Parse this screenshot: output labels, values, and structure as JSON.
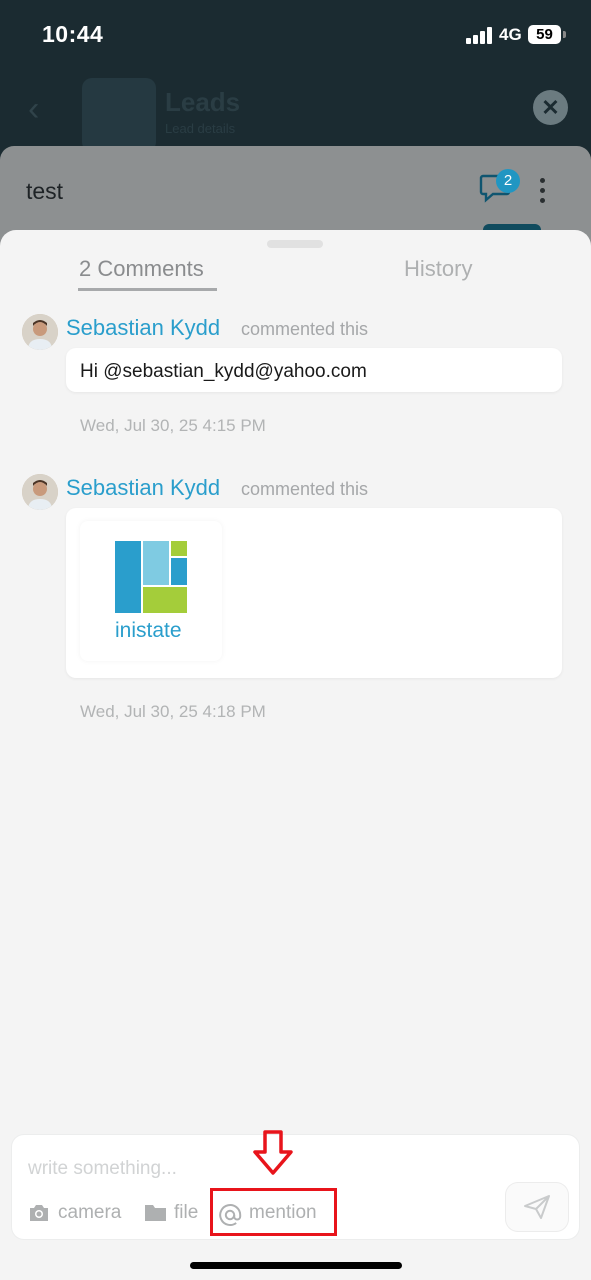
{
  "status_bar": {
    "time": "10:44",
    "network": "4G",
    "battery": "59"
  },
  "background_screen": {
    "title": "Leads",
    "subtitle": "Lead details"
  },
  "record_sheet": {
    "title": "test",
    "comment_count": "2"
  },
  "tabs": {
    "comments": "2 Comments",
    "history": "History"
  },
  "comments": [
    {
      "author": "Sebastian Kydd",
      "action": "commented this",
      "text": "Hi @sebastian_kydd@yahoo.com",
      "timestamp": "Wed, Jul 30, 25 4:15 PM"
    },
    {
      "author": "Sebastian Kydd",
      "action": "commented this",
      "attachment_label": "inistate",
      "timestamp": "Wed, Jul 30, 25 4:18 PM"
    }
  ],
  "composer": {
    "placeholder": "write something...",
    "camera_label": "camera",
    "file_label": "file",
    "mention_label": "mention"
  },
  "colors": {
    "accent": "#2a9ecc",
    "highlight": "#e8141b",
    "logo_blue": "#2a9ecc",
    "logo_light": "#7fcbe2",
    "logo_green": "#a4cd3a"
  }
}
